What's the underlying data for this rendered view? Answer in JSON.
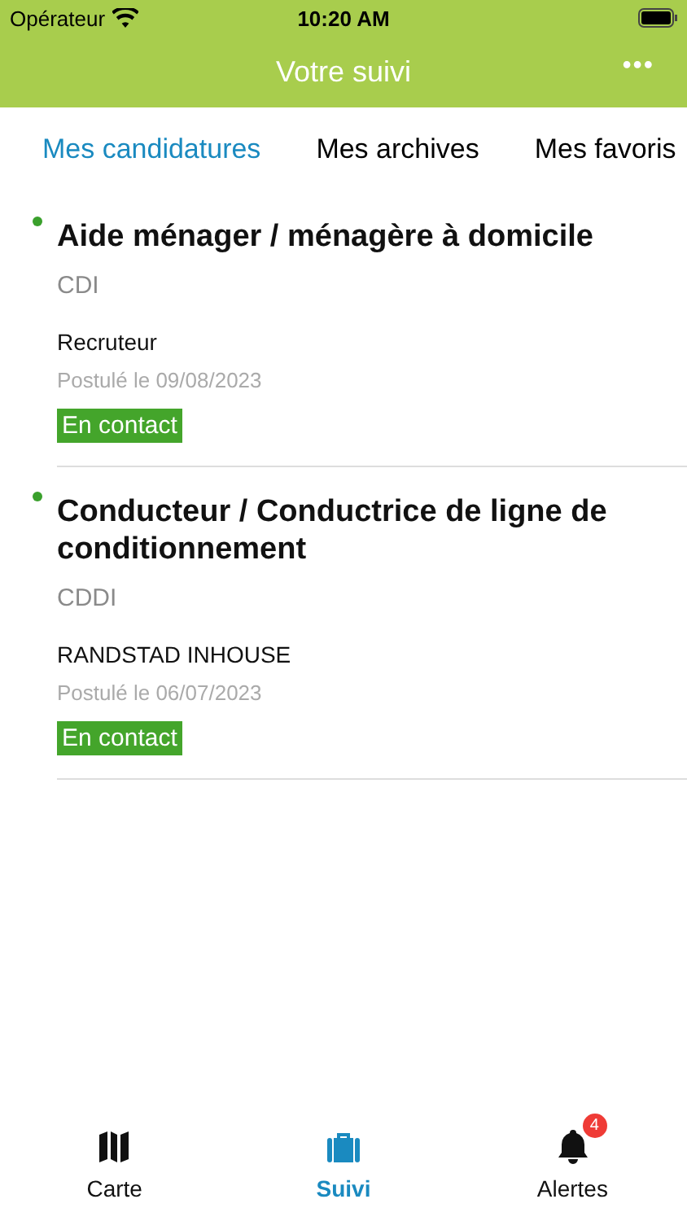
{
  "status_bar": {
    "carrier": "Opérateur",
    "time": "10:20 AM"
  },
  "nav_bar": {
    "title": "Votre suivi",
    "menu": "•••"
  },
  "tabs": [
    {
      "label": "Mes candidatures",
      "selected": true
    },
    {
      "label": "Mes archives",
      "selected": false
    },
    {
      "label": "Mes favoris",
      "selected": false
    }
  ],
  "applications": [
    {
      "title": "Aide ménager / ménagère à domicile",
      "contract": "CDI",
      "recruiter": "Recruteur",
      "applied": "Postulé le 09/08/2023",
      "status": "En contact",
      "unread": true
    },
    {
      "title": "Conducteur / Conductrice de ligne de conditionnement",
      "contract": "CDDI",
      "recruiter": "RANDSTAD INHOUSE",
      "applied": "Postulé le 06/07/2023",
      "status": "En contact",
      "unread": true
    }
  ],
  "bottom_tabs": [
    {
      "kind": "map",
      "label": "Carte",
      "selected": false
    },
    {
      "kind": "briefcase",
      "label": "Suivi",
      "selected": true
    },
    {
      "kind": "bell",
      "label": "Alertes",
      "selected": false,
      "badge": "4"
    }
  ]
}
